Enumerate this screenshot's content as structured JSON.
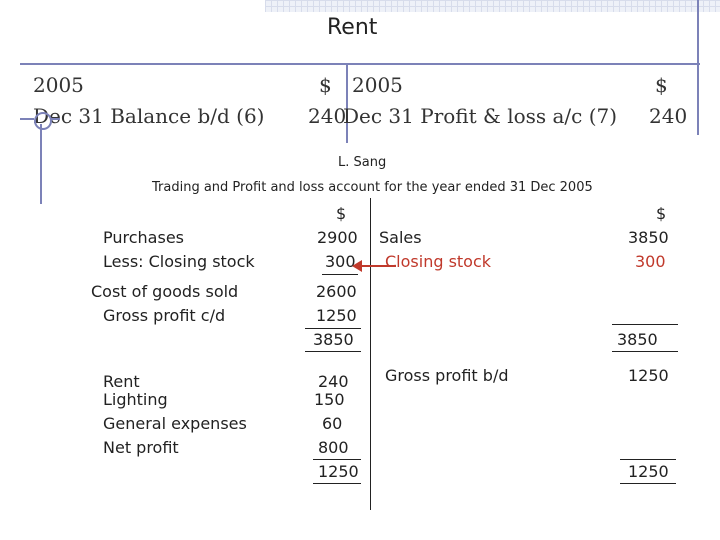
{
  "rent_account": {
    "title": "Rent",
    "left": {
      "year": "2005",
      "dollar": "$",
      "entry": "Dec 31  Balance b/d (6)",
      "amount": "240"
    },
    "right": {
      "year": "2005",
      "dollar": "$",
      "entry": "Dec 31  Profit & loss a/c (7)",
      "amount": "240"
    }
  },
  "statement": {
    "business": "L. Sang",
    "title": "Trading and Profit and loss account for the year ended 31 Dec 2005",
    "debit": {
      "dollar": "$",
      "purchases_label": "Purchases",
      "purchases_value": "2900",
      "closing_stock_label": "Less: Closing stock",
      "closing_stock_value": "300",
      "cogs_label": "Cost of goods sold",
      "cogs_value": "2600",
      "gross_profit_label": "Gross profit c/d",
      "gross_profit_value": "1250",
      "trading_total": "3850",
      "expenses": [
        {
          "label": "Rent",
          "value": "240"
        },
        {
          "label": "Lighting",
          "value": "150"
        },
        {
          "label": "General expenses",
          "value": "60"
        },
        {
          "label": "Net profit",
          "value": "800"
        }
      ],
      "pl_total": "1250"
    },
    "credit": {
      "dollar": "$",
      "sales_label": "Sales",
      "sales_value": "3850",
      "closing_stock_label": "Closing stock",
      "closing_stock_value": "300",
      "trading_total": "3850",
      "gross_profit_bd_label": "Gross profit b/d",
      "gross_profit_bd_value": "1250",
      "pl_total": "1250"
    }
  },
  "colors": {
    "rule": "#7c82b8",
    "highlight": "#c0392b",
    "text": "#222222"
  }
}
